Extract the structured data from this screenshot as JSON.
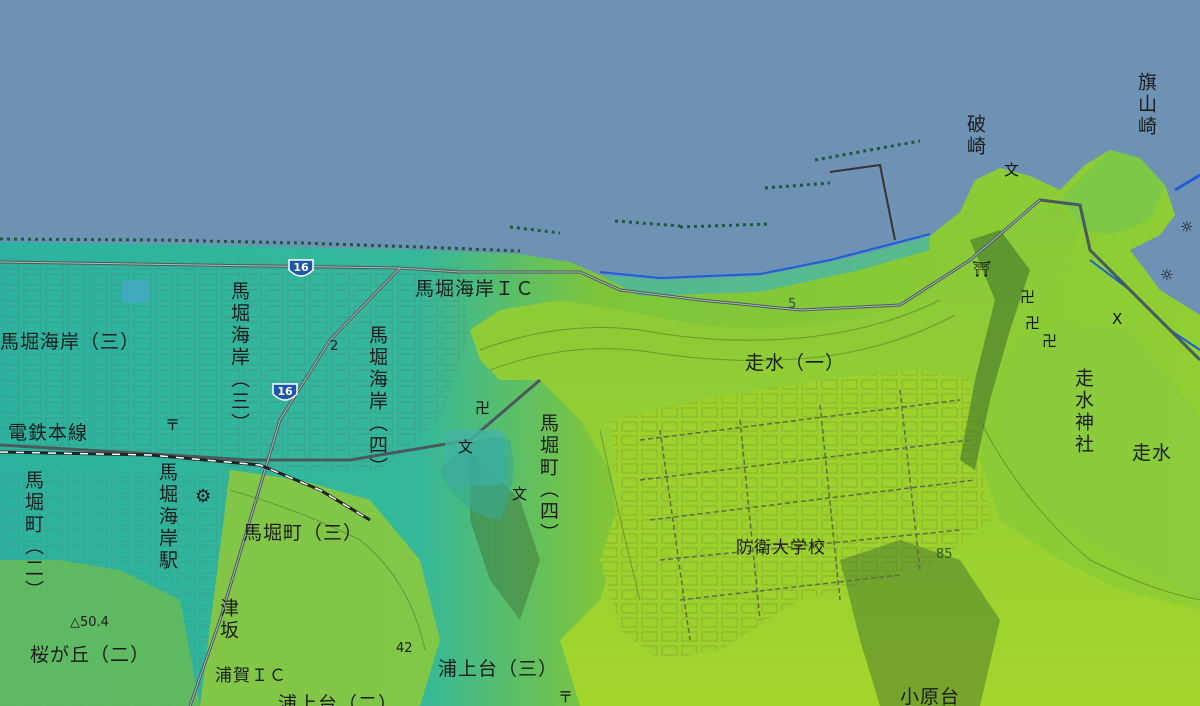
{
  "map": {
    "colors": {
      "sea": "#6d92b4",
      "lowland": "#2fb39a",
      "lowland_dark": "#249885",
      "upland": "#8fcf33",
      "upland_light": "#a8d62f",
      "plateau": "#9ccf2a",
      "road": "#5b6b6e",
      "coast": "#1f5fd6"
    },
    "route_shields": [
      {
        "number": "16"
      },
      {
        "number": "16"
      }
    ],
    "place_labels": {
      "hatayama": "旗山崎",
      "hazaki": "破崎",
      "maborikaigan_ic": "馬堀海岸ＩＣ",
      "maborikaigan_3": "馬堀海岸（三）",
      "maborikaigan_v1": "馬堀海岸（三）",
      "maborikaigan_v2": "馬堀海岸（四）",
      "denshasen": "電鉄本線",
      "maborichou_left": "馬堀町（二）",
      "maborikaigan_eki": "馬堀海岸駅",
      "maborichou_3": "馬堀町（三）",
      "maborichou_4": "馬堀町（四）",
      "hashirimizu_1": "走水（一）",
      "hashirimizu_jinja": "走水神社",
      "hashirimizu": "走水",
      "boueidaigakkou": "防衛大学校",
      "tsuzaka": "津坂",
      "sakuragaoka_2": "桜が丘（二）",
      "uraga_ic": "浦賀ＩＣ",
      "uragamidai_3": "浦上台（三）",
      "uragamidai_2": "浦上台（二）",
      "kobaradai": "小原台"
    },
    "elevations": {
      "peak_50": "△50.4",
      "h42": "42",
      "h85": "85",
      "h5": "5",
      "h2": "2"
    },
    "symbols": {
      "school": "文",
      "temple": "卍",
      "shrine": "⛩",
      "post": "〒",
      "factory": "⚙",
      "police": "X",
      "lighthouse": "☼"
    }
  }
}
